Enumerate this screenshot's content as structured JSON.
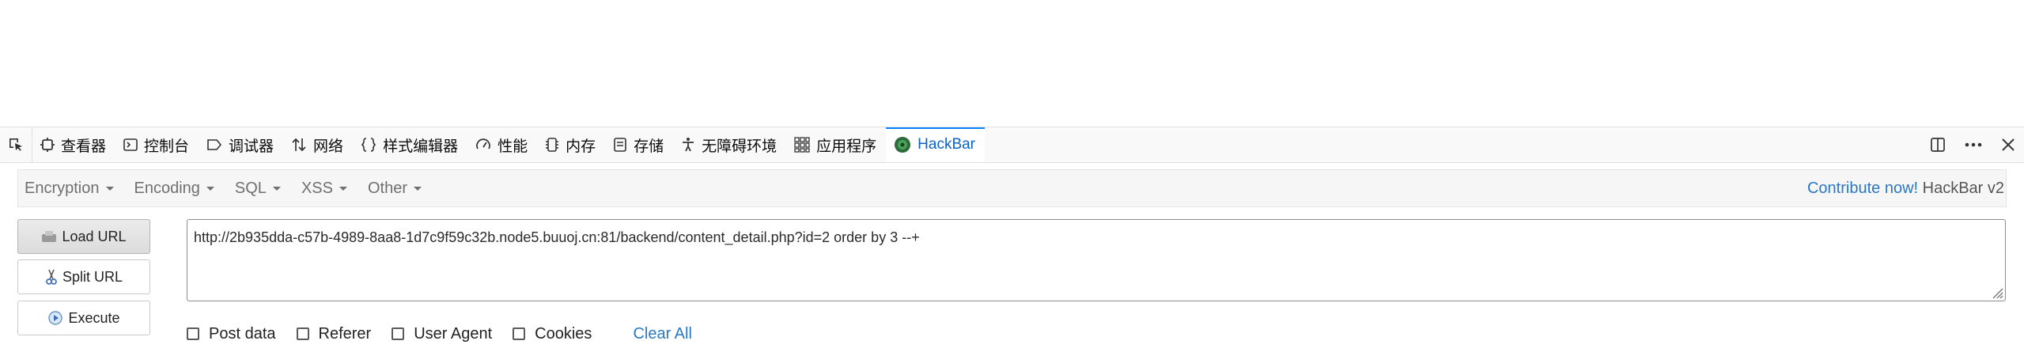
{
  "devtools": {
    "tabs": [
      {
        "label": "查看器",
        "icon": "inspector-icon"
      },
      {
        "label": "控制台",
        "icon": "console-icon"
      },
      {
        "label": "调试器",
        "icon": "debugger-icon"
      },
      {
        "label": "网络",
        "icon": "network-icon"
      },
      {
        "label": "样式编辑器",
        "icon": "style-editor-icon"
      },
      {
        "label": "性能",
        "icon": "performance-icon"
      },
      {
        "label": "内存",
        "icon": "memory-icon"
      },
      {
        "label": "存储",
        "icon": "storage-icon"
      },
      {
        "label": "无障碍环境",
        "icon": "accessibility-icon"
      },
      {
        "label": "应用程序",
        "icon": "application-icon"
      },
      {
        "label": "HackBar",
        "icon": "hackbar-icon",
        "active": true
      }
    ],
    "right_icons": [
      "dock-icon",
      "more-icon",
      "close-icon"
    ]
  },
  "hackbar": {
    "menus": [
      "Encryption",
      "Encoding",
      "SQL",
      "XSS",
      "Other"
    ],
    "contribute_label": "Contribute now!",
    "version_label": "HackBar v2",
    "buttons": {
      "load": "Load URL",
      "split": "Split URL",
      "execute": "Execute"
    },
    "url_value": "http://2b935dda-c57b-4989-8aa8-1d7c9f59c32b.node5.buuoj.cn:81/backend/content_detail.php?id=2 order by 3 --+",
    "options": [
      "Post data",
      "Referer",
      "User Agent",
      "Cookies"
    ],
    "clear_all": "Clear All"
  },
  "colors": {
    "accent": "#0a84ff",
    "link": "#2a78c4",
    "hackbar_icon": "#2e6b3a"
  }
}
